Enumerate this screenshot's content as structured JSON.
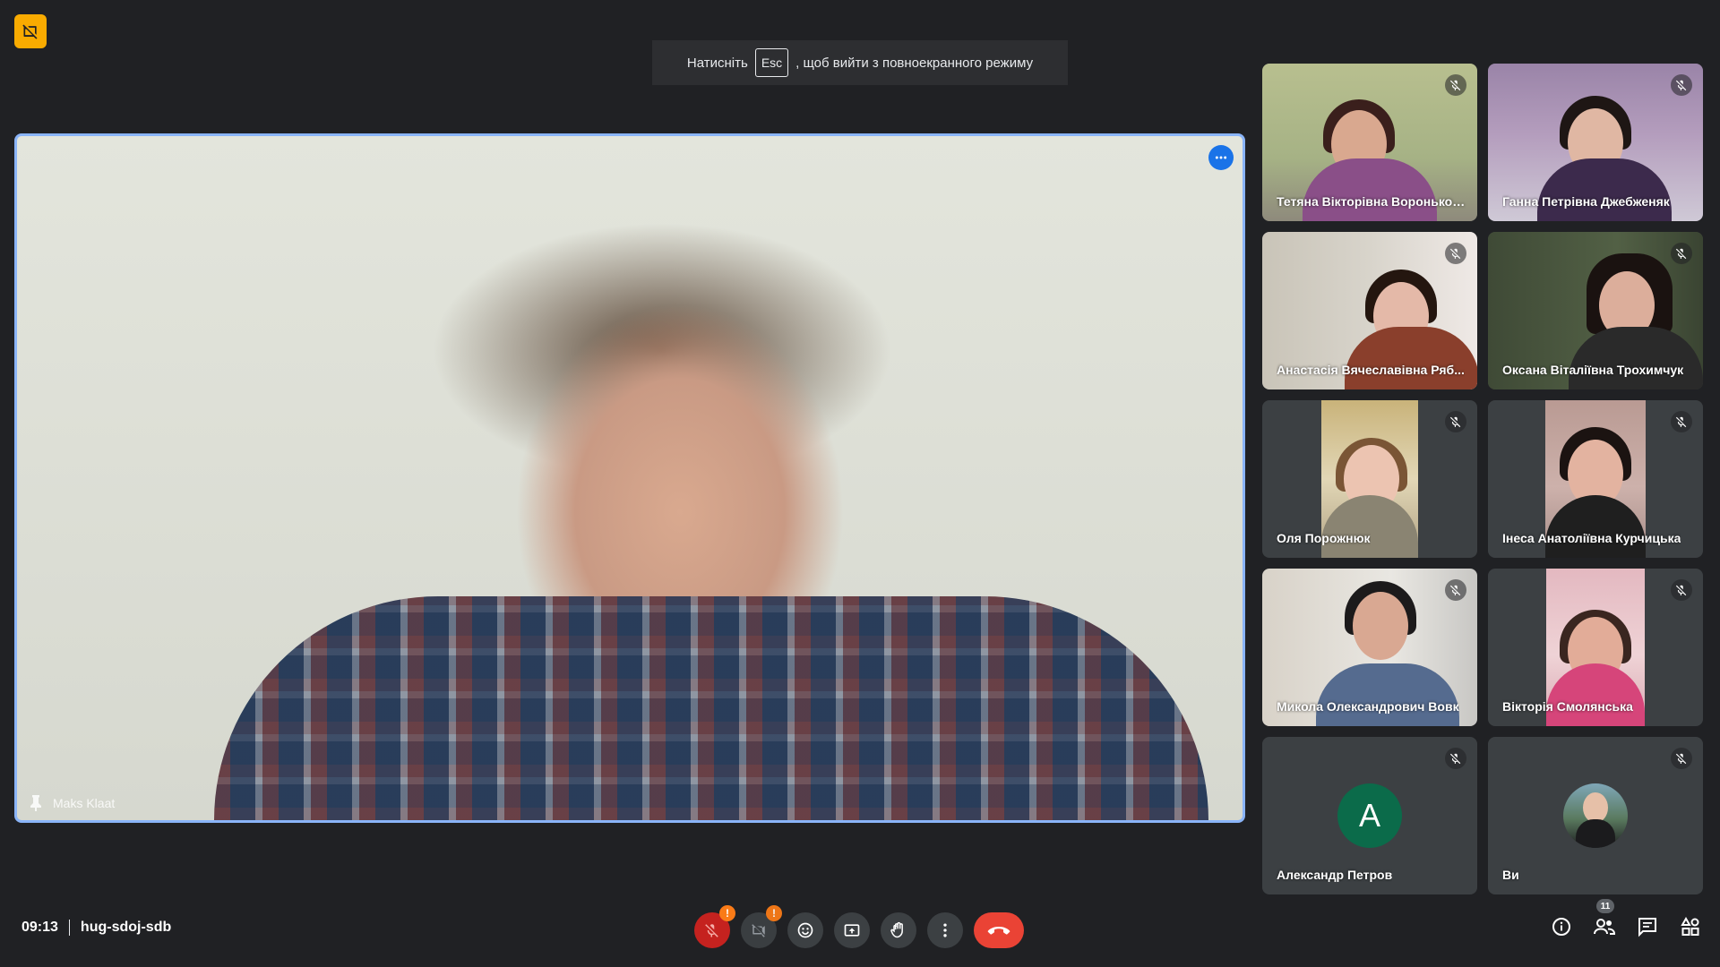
{
  "toast": {
    "before": "Натисніть",
    "key": "Esc",
    "after": ", щоб вийти з повноекранного режиму"
  },
  "main_speaker": {
    "name": "Maks Klaat"
  },
  "participants": [
    {
      "name": "Тетяна Вікторівна Воронько-...",
      "muted": true
    },
    {
      "name": "Ганна Петрівна Джебженяк",
      "muted": true
    },
    {
      "name": "Анастасія Вячеславівна Ряб...",
      "muted": true
    },
    {
      "name": "Оксана Віталіївна Трохимчук",
      "muted": true
    },
    {
      "name": "Оля Порожнюк",
      "muted": true
    },
    {
      "name": "Інеса Анатоліївна Курчицька",
      "muted": true
    },
    {
      "name": "Микола Олександрович Вовк",
      "muted": true
    },
    {
      "name": "Вікторія Смолянська",
      "muted": true
    },
    {
      "name": "Александр Петров",
      "muted": true,
      "avatar_letter": "A",
      "avatar_color": "#0b6b4a"
    },
    {
      "name": "Ви",
      "muted": true
    }
  ],
  "meeting": {
    "time": "09:13",
    "code": "hug-sdoj-sdb"
  },
  "controls": {
    "mic_warning": "!",
    "camera_warning": "!",
    "people_count": "11"
  },
  "colors": {
    "background": "#202124",
    "accent_blue": "#8ab4f8",
    "end_call_red": "#ea4335",
    "warning_orange": "#fa7b17",
    "badge_yellow": "#f9ab00"
  }
}
